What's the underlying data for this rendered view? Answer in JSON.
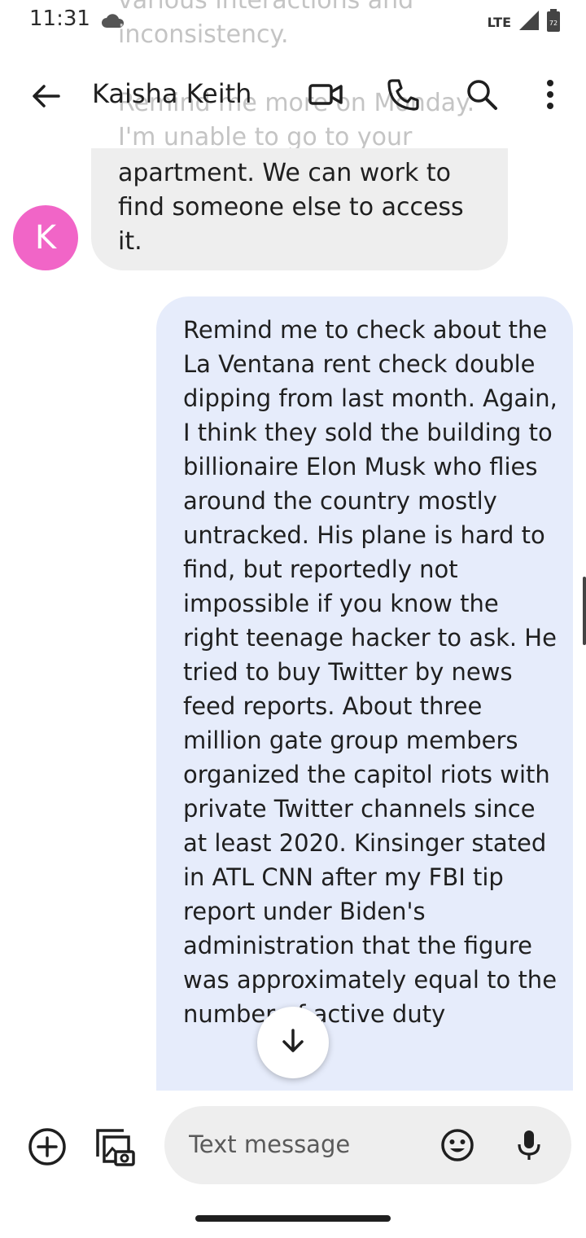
{
  "status_bar": {
    "time": "11:31",
    "network": "LTE",
    "battery_level": "72"
  },
  "conversation": {
    "contact_name": "Kaisha Keith",
    "avatar_initial": "K"
  },
  "ghost_text": {
    "line1": "various interactions and",
    "line2": "inconsistency.",
    "line3": "Remind me more on Monday.",
    "line4": "I'm unable to go to your"
  },
  "received_message": {
    "text": "apartment. We can work to find someone else to access it."
  },
  "sent_message": {
    "text": "Remind me to check about the La Ventana rent check double dipping from last month. Again, I think they sold the building to billionaire Elon Musk who flies around the country mostly untracked. His plane is hard to find, but reportedly not impossible if you know the right teenage hacker to ask. He tried to buy Twitter by news feed reports. About three million gate group members organized the capitol riots with private Twitter channels since at least 2020. Kinsinger stated in ATL CNN after my FBI tip report under Biden's administration that the figure was approximately equal to the number of active duty"
  },
  "compose": {
    "placeholder": "Text message"
  },
  "icons": {
    "back": "arrow-back-icon",
    "video": "video-call-icon",
    "phone": "phone-icon",
    "search": "search-icon",
    "more": "more-vert-icon",
    "add": "add-circle-icon",
    "gallery": "gallery-icon",
    "emoji": "emoji-icon",
    "mic": "mic-icon",
    "scroll_down": "arrow-down-icon"
  },
  "colors": {
    "sent_bubble": "#e6ecfb",
    "received_bubble": "#eeeeee",
    "avatar": "#f165c7",
    "text": "#1f1f1f"
  }
}
